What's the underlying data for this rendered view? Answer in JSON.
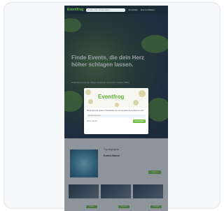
{
  "header": {
    "logo": "Eventfrog",
    "search_placeholder": "Event, Ort, Veranstalter…",
    "nav": [
      "Anmelden",
      "Event erfassen"
    ]
  },
  "hero": {
    "title": "Finde Events, die dein Herz höher schlagen lassen.",
    "subtitle": "Entdecke Konzerte, Partys, Festivals und mehr in deiner Nähe"
  },
  "modal": {
    "logo": "Eventfrog",
    "text": "Melde dich für unseren Newsletter an und verpasse keine Events mehr.",
    "input_placeholder": "E-Mail-Adresse",
    "skip": "Nein danke",
    "cta": "Anmelden"
  },
  "section": {
    "heading": "Top-Highlights",
    "feature_title": "Event-Name",
    "feature_cta": "Tickets",
    "event_cta": "Tickets"
  },
  "colors": {
    "brand": "#6ebd45",
    "topbar": "#1a2d37"
  }
}
